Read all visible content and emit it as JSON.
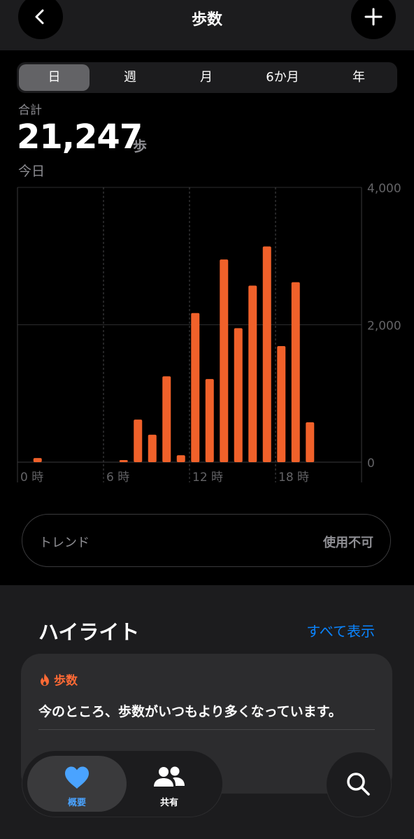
{
  "header": {
    "title": "歩数"
  },
  "segments": [
    "日",
    "週",
    "月",
    "6か月",
    "年"
  ],
  "selected_segment": 0,
  "summary": {
    "label": "合計",
    "value": "21,247",
    "unit": "歩",
    "date": "今日"
  },
  "chart_data": {
    "type": "bar",
    "x": [
      1,
      7,
      8,
      9,
      10,
      11,
      12,
      13,
      14,
      15,
      16,
      17,
      18,
      19,
      20
    ],
    "values": [
      60,
      20,
      620,
      400,
      1250,
      100,
      2170,
      1210,
      2950,
      1950,
      2570,
      3140,
      1690,
      2620,
      580
    ],
    "ylim": [
      0,
      4000
    ],
    "y_ticks": [
      "4,000",
      "2,000",
      "0"
    ],
    "y_tick_values": [
      4000,
      2000,
      0
    ],
    "x_ticks": [
      "0 時",
      "6 時",
      "12 時",
      "18 時"
    ],
    "x_tick_values": [
      0,
      6,
      12,
      18
    ],
    "xlim": [
      0,
      24
    ],
    "bar_color": "#f0612a"
  },
  "trend": {
    "label": "トレンド",
    "value": "使用不可"
  },
  "highlights": {
    "title": "ハイライト",
    "show_all": "すべて表示",
    "card": {
      "icon": "flame-icon",
      "category": "歩数",
      "text": "今のところ、歩数がいつもより多くなっています。"
    }
  },
  "tabbar": {
    "summary_label": "概要",
    "shared_label": "共有"
  },
  "colors": {
    "accent_blue": "#0a84ff",
    "orange": "#ff6a35",
    "tab_blue": "#4aa3ff"
  }
}
